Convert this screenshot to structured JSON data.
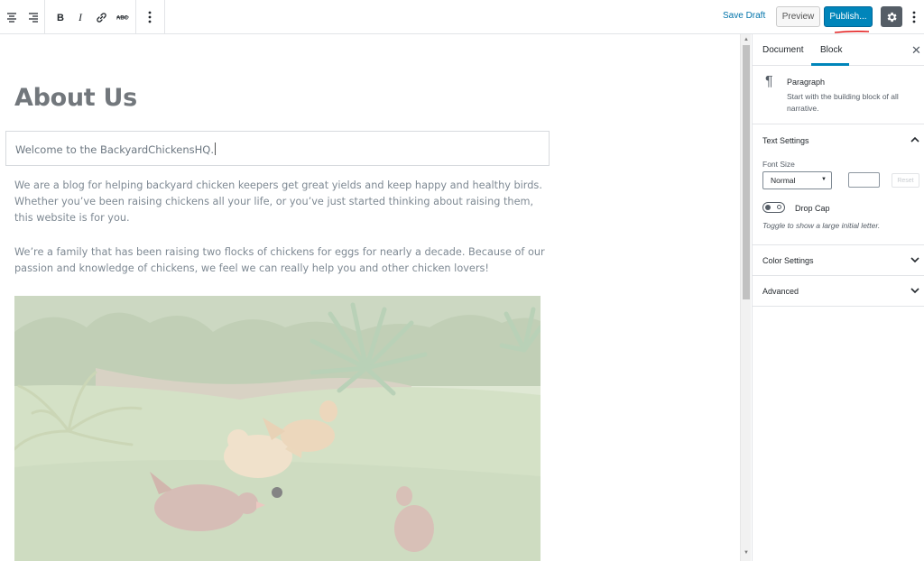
{
  "toolbar": {
    "save_draft": "Save Draft",
    "preview": "Preview",
    "publish": "Publish...",
    "accent_color": "#0085ba"
  },
  "editor": {
    "title": "About Us",
    "paragraph_active": "Welcome to the BackyardChickensHQ.",
    "paragraph_1": "We are a blog for helping backyard chicken keepers get great yields and keep happy and healthy birds. Whether you’ve been raising chickens all your life, or you’ve just started thinking about raising them, this website is for you.",
    "paragraph_2": "We’re a family that has been raising two flocks of chickens for eggs for nearly a decade. Because of our passion and knowledge of chickens, we feel we can really help you and other chicken lovers!"
  },
  "sidebar": {
    "tabs": [
      {
        "label": "Document"
      },
      {
        "label": "Block",
        "active": true
      }
    ],
    "block": {
      "name": "Paragraph",
      "description": "Start with the building block of all narrative."
    },
    "text_settings": {
      "title": "Text Settings",
      "font_size_label": "Font Size",
      "font_size_value": "Normal",
      "reset_label": "Reset",
      "drop_cap_label": "Drop Cap",
      "drop_cap_help": "Toggle to show a large initial letter."
    },
    "color_settings": {
      "title": "Color Settings"
    },
    "advanced": {
      "title": "Advanced"
    }
  },
  "icons": [
    "align-center-icon",
    "align-right-icon",
    "bold-icon",
    "italic-icon",
    "link-icon",
    "strikethrough-icon",
    "more-vertical-icon",
    "gear-icon",
    "close-icon",
    "pilcrow-icon",
    "chevron-up-icon",
    "chevron-down-icon"
  ]
}
